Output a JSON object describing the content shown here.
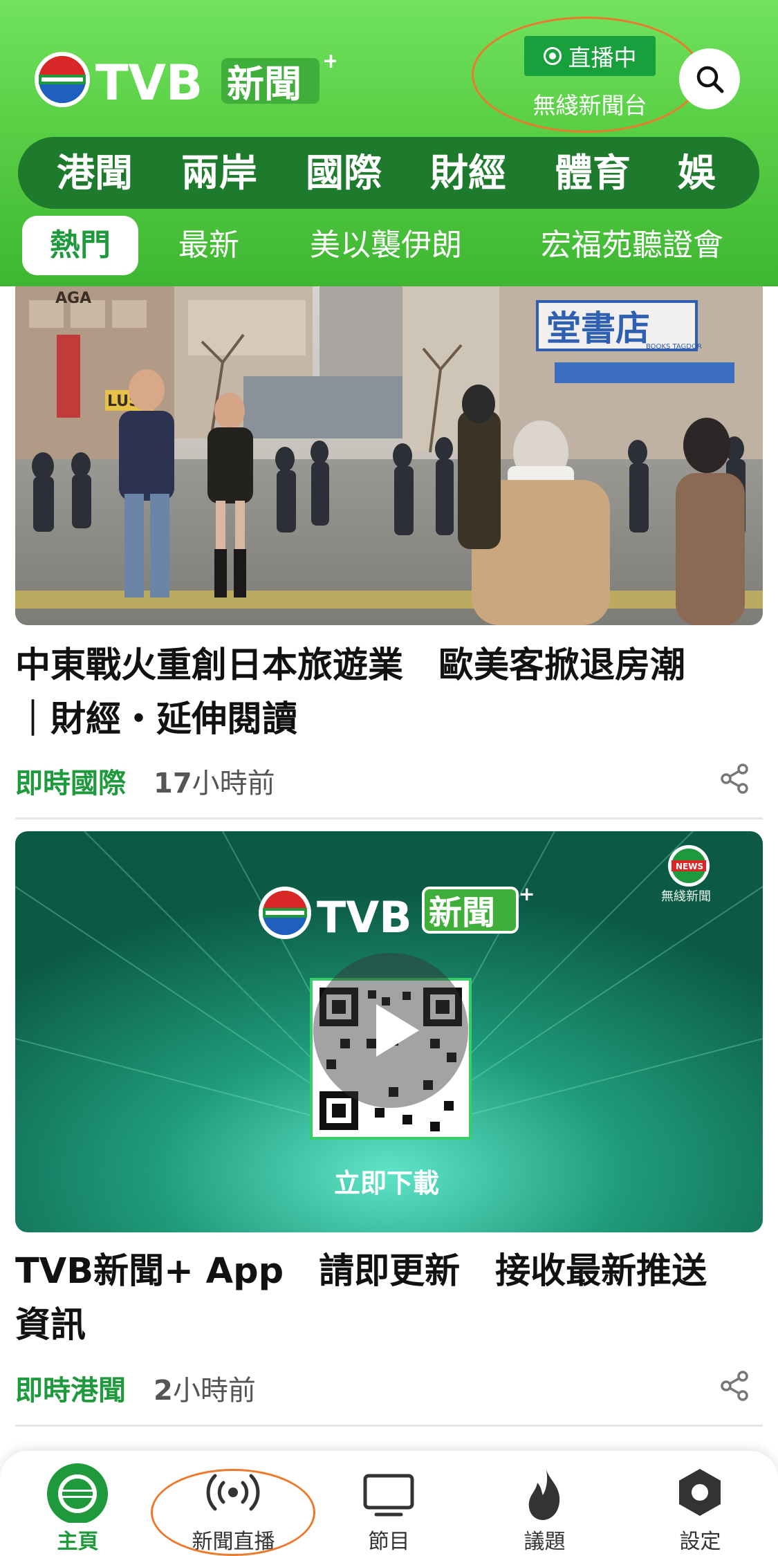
{
  "header": {
    "brand": "TVB",
    "brand_suffix": "新聞",
    "brand_plus": "+",
    "live_label": "直播中",
    "channel_name": "無綫新聞台"
  },
  "categories": [
    "港聞",
    "兩岸",
    "國際",
    "財經",
    "體育",
    "娛"
  ],
  "subtabs": [
    "熱門",
    "最新",
    "美以襲伊朗",
    "宏福苑聽證會"
  ],
  "articles": [
    {
      "title_line1": "中東戰火重創日本旅遊業　歐美客掀退房潮",
      "title_line2": "｜財經・延伸閱讀",
      "category": "即時國際",
      "time_num": "17",
      "time_unit": "小時前"
    },
    {
      "title_line1": "TVB新聞+ App　請即更新　接收最新推送",
      "title_line2": "資訊",
      "category": "即時港聞",
      "time_num": "2",
      "time_unit": "小時前"
    }
  ],
  "photo_signs": {
    "bookstore": "堂書店",
    "bookstore_small": "BOOKS TAGDOR",
    "building": "AGA",
    "lus": "LUS"
  },
  "promo": {
    "brand": "TVB",
    "brand_suffix": "新聞",
    "brand_plus": "+",
    "download_label": "立即下載",
    "corner_badge": "NEWS",
    "corner_caption": "無綫新聞"
  },
  "bottom_nav": [
    {
      "label": "主頁",
      "icon": "home-tvb-icon",
      "active": true
    },
    {
      "label": "新聞直播",
      "icon": "broadcast-icon",
      "active": false
    },
    {
      "label": "節目",
      "icon": "tv-icon",
      "active": false
    },
    {
      "label": "議題",
      "icon": "flame-icon",
      "active": false
    },
    {
      "label": "設定",
      "icon": "settings-hexagon-icon",
      "active": false
    }
  ],
  "colors": {
    "brand_green": "#1e9a3c",
    "header_green": "#58cf45",
    "category_bar": "#1e7a2c",
    "annotation_orange": "#ec7a2c"
  }
}
